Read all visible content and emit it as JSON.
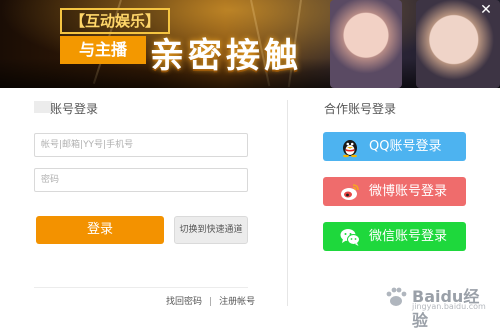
{
  "banner": {
    "tag": "【互动娱乐】",
    "subtitle": "与主播",
    "headline": "亲密接触"
  },
  "window": {
    "close_label": "✕"
  },
  "account_login": {
    "title": "账号登录",
    "account_placeholder": "帐号|邮箱|YY号|手机号",
    "password_placeholder": "密码",
    "login_button": "登录",
    "quick_channel_button": "切换到快速通道",
    "forgot_password": "找回密码",
    "separator": "|",
    "register": "注册帐号"
  },
  "partner_login": {
    "title": "合作账号登录",
    "qq": "QQ账号登录",
    "weibo": "微博账号登录",
    "wechat": "微信账号登录"
  },
  "colors": {
    "login": "#f39200",
    "qq": "#4db3f0",
    "weibo": "#ef6c6c",
    "wechat": "#1ed83c"
  },
  "watermark": {
    "logo_text": "Baidu经验",
    "sub_text": "jingyan.baidu.com"
  }
}
